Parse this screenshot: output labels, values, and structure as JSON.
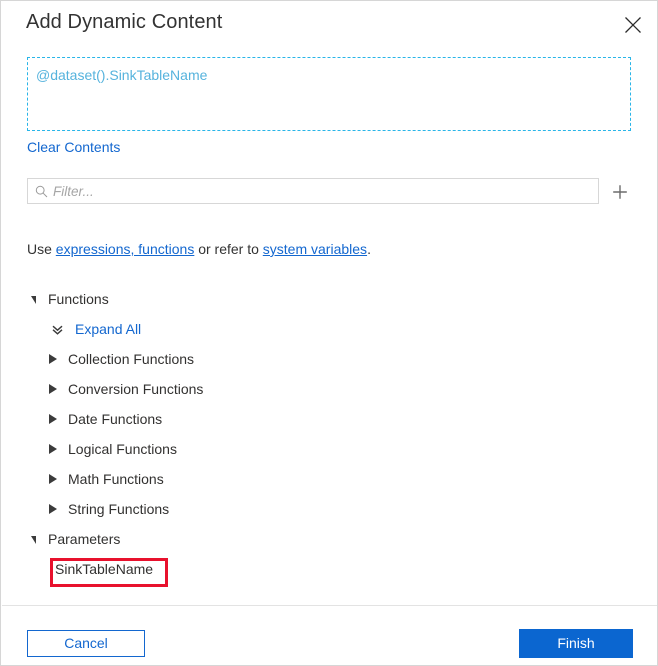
{
  "dialog": {
    "title": "Add Dynamic Content",
    "close_icon": "close-icon"
  },
  "expression": {
    "value": "@dataset().SinkTableName",
    "clear_label": "Clear Contents"
  },
  "filter": {
    "placeholder": "Filter...",
    "value": "",
    "search_icon": "search-icon",
    "add_icon": "plus-icon"
  },
  "hint": {
    "prefix": "Use ",
    "link1": "expressions, functions",
    "middle": " or refer to ",
    "link2": "system variables",
    "suffix": "."
  },
  "tree": {
    "functions_label": "Functions",
    "expand_all_label": "Expand All",
    "categories": [
      {
        "label": "Collection Functions"
      },
      {
        "label": "Conversion Functions"
      },
      {
        "label": "Date Functions"
      },
      {
        "label": "Logical Functions"
      },
      {
        "label": "Math Functions"
      },
      {
        "label": "String Functions"
      }
    ],
    "parameters_label": "Parameters",
    "parameters": [
      {
        "label": "SinkTableName"
      }
    ]
  },
  "footer": {
    "cancel_label": "Cancel",
    "finish_label": "Finish"
  },
  "colors": {
    "accent_blue": "#0b66d0",
    "link_blue": "#1367cf",
    "expression_text": "#56b3dd",
    "expression_border": "#29b5e8",
    "annotation_red": "#e8112d"
  }
}
